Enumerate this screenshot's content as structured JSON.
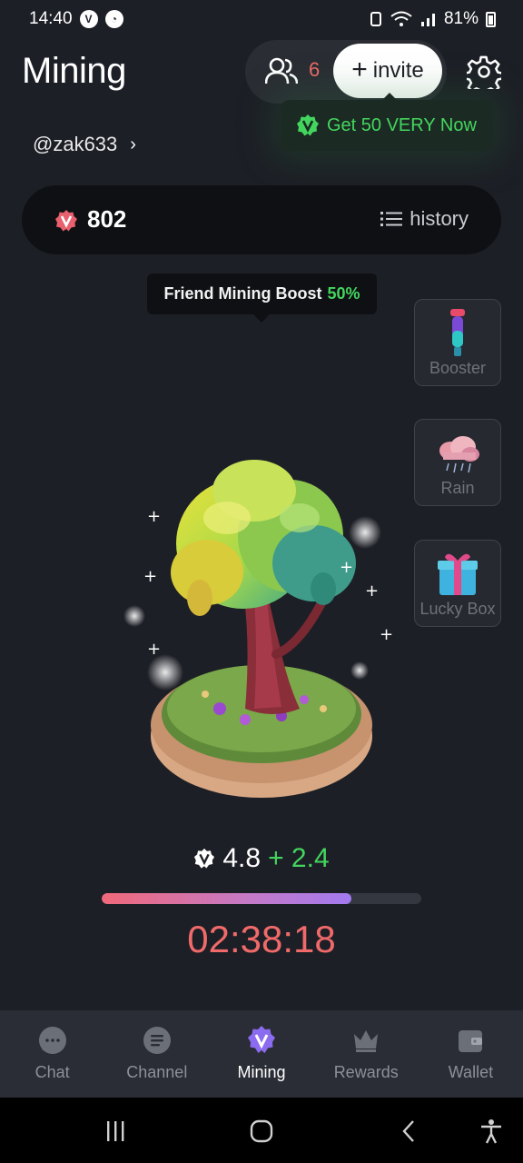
{
  "status_bar": {
    "time": "14:40",
    "battery": "81%"
  },
  "header": {
    "title": "Mining",
    "friends_count": "6",
    "invite_label": "invite"
  },
  "promo": {
    "text": "Get 50 VERY Now"
  },
  "user": {
    "handle": "@zak633"
  },
  "balance": {
    "value": "802",
    "history_label": "history"
  },
  "boost": {
    "label": "Friend Mining Boost",
    "percent": "50%"
  },
  "side_buttons": [
    {
      "label": "Booster"
    },
    {
      "label": "Rain"
    },
    {
      "label": "Lucky Box"
    }
  ],
  "mining": {
    "rate": "4.8",
    "bonus": "+ 2.4",
    "progress": 0.78,
    "timer": "02:38:18"
  },
  "nav": [
    {
      "label": "Chat",
      "icon": "chat-icon"
    },
    {
      "label": "Channel",
      "icon": "channel-icon"
    },
    {
      "label": "Mining",
      "icon": "mining-v-icon",
      "active": true
    },
    {
      "label": "Rewards",
      "icon": "crown-icon"
    },
    {
      "label": "Wallet",
      "icon": "wallet-icon"
    }
  ],
  "colors": {
    "accent_green": "#43d65e",
    "accent_red": "#f06a6a",
    "accent_purple": "#8b6cf0",
    "background": "#1d1f26"
  }
}
